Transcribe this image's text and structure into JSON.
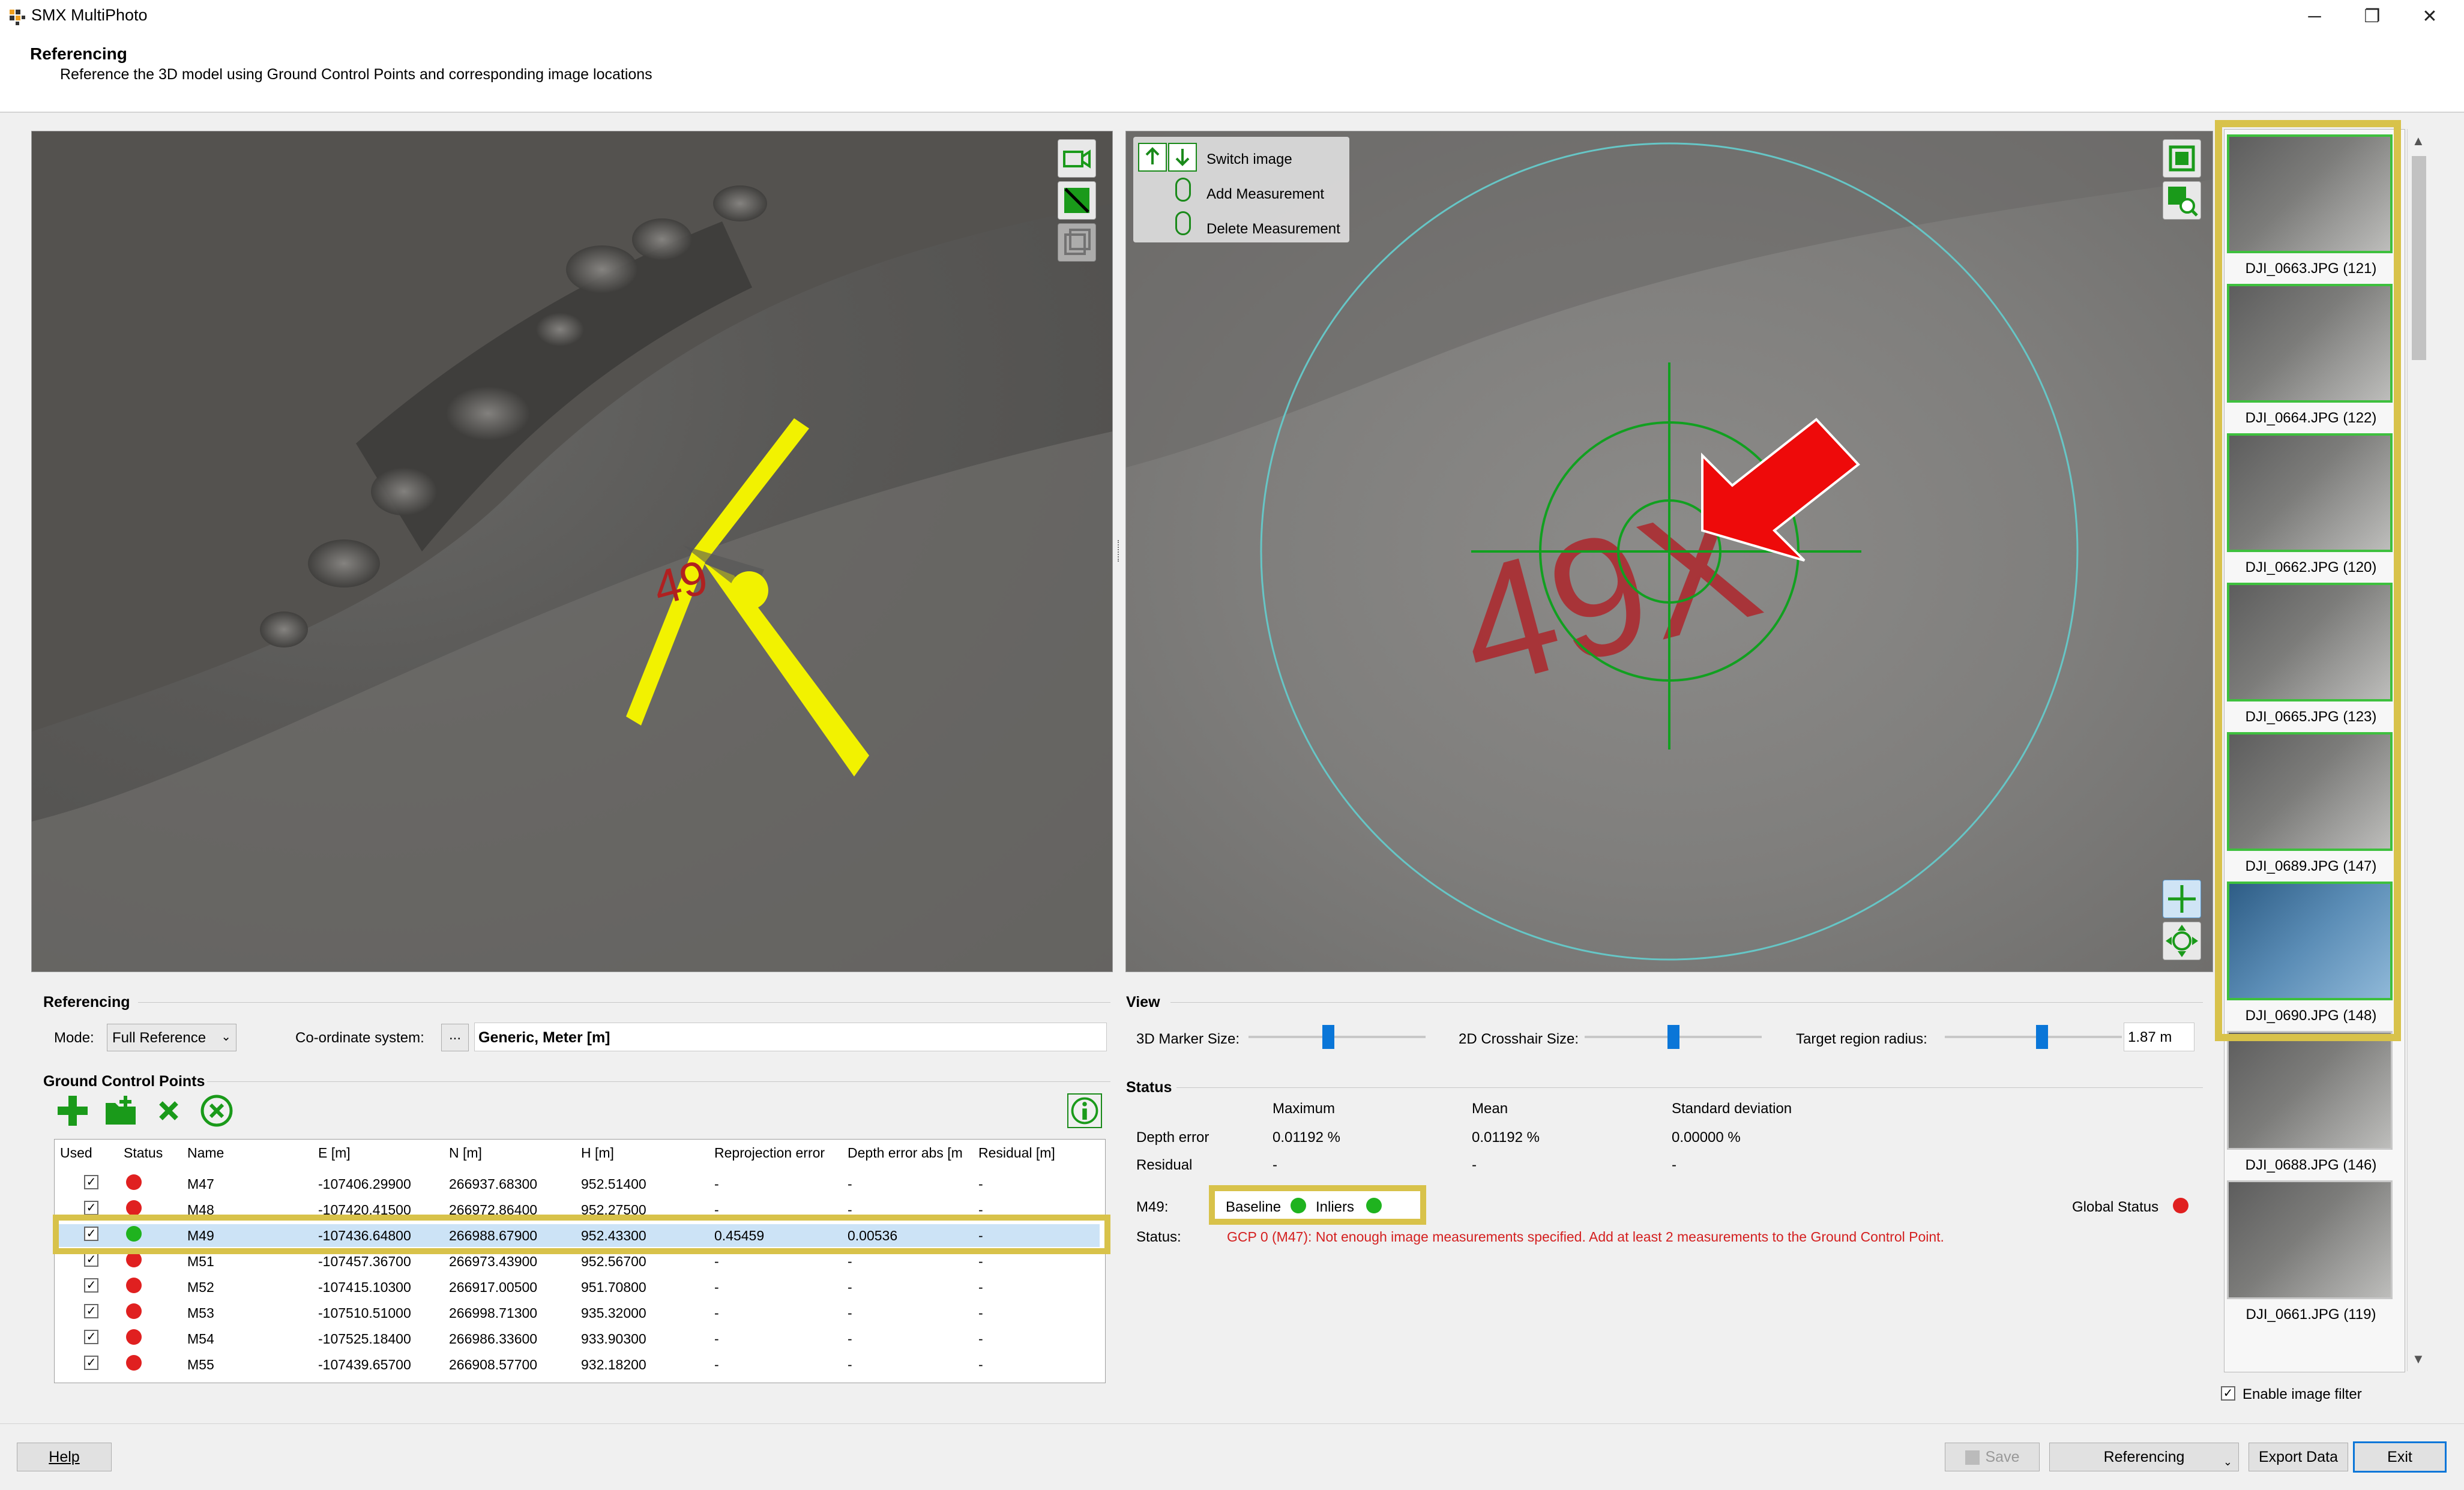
{
  "window": {
    "title": "SMX MultiPhoto",
    "minimize": "─",
    "maximize": "❐",
    "close": "✕"
  },
  "header": {
    "title": "Referencing",
    "subtitle": "Reference the 3D model using Ground Control Points and corresponding image locations"
  },
  "right_view": {
    "switch_image": "Switch image",
    "add_measurement": "Add Measurement",
    "delete_measurement": "Delete Measurement"
  },
  "thumbnails": [
    {
      "label": "DJI_0663.JPG (121)",
      "state": "measured"
    },
    {
      "label": "DJI_0664.JPG (122)",
      "state": "measured"
    },
    {
      "label": "DJI_0662.JPG (120)",
      "state": "measured"
    },
    {
      "label": "DJI_0665.JPG (123)",
      "state": "measured"
    },
    {
      "label": "DJI_0689.JPG (147)",
      "state": "measured"
    },
    {
      "label": "DJI_0690.JPG (148)",
      "state": "selected"
    },
    {
      "label": "DJI_0688.JPG (146)",
      "state": "plain"
    },
    {
      "label": "DJI_0661.JPG (119)",
      "state": "plain"
    }
  ],
  "enable_filter": "Enable image filter",
  "referencing": {
    "title": "Referencing",
    "mode_label": "Mode:",
    "mode_value": "Full Reference",
    "coord_label": "Co-ordinate system:",
    "coord_button": "...",
    "coord_value": "Generic, Meter [m]"
  },
  "gcp": {
    "title": "Ground Control Points",
    "columns": [
      "Used",
      "Status",
      "Name",
      "E [m]",
      "N [m]",
      "H [m]",
      "Reprojection error",
      "Depth error abs [m",
      "Residual [m]"
    ],
    "rows": [
      {
        "used": "✓",
        "status": "red",
        "name": "M47",
        "e": "-107406.29900",
        "n": "266937.68300",
        "h": "952.51400",
        "reproj": "-",
        "depth": "-",
        "resid": "-"
      },
      {
        "used": "✓",
        "status": "red",
        "name": "M48",
        "e": "-107420.41500",
        "n": "266972.86400",
        "h": "952.27500",
        "reproj": "-",
        "depth": "-",
        "resid": "-"
      },
      {
        "used": "✓",
        "status": "green",
        "name": "M49",
        "e": "-107436.64800",
        "n": "266988.67900",
        "h": "952.43300",
        "reproj": "0.45459",
        "depth": "0.00536",
        "resid": "-"
      },
      {
        "used": "✓",
        "status": "red",
        "name": "M51",
        "e": "-107457.36700",
        "n": "266973.43900",
        "h": "952.56700",
        "reproj": "-",
        "depth": "-",
        "resid": "-"
      },
      {
        "used": "✓",
        "status": "red",
        "name": "M52",
        "e": "-107415.10300",
        "n": "266917.00500",
        "h": "951.70800",
        "reproj": "-",
        "depth": "-",
        "resid": "-"
      },
      {
        "used": "✓",
        "status": "red",
        "name": "M53",
        "e": "-107510.51000",
        "n": "266998.71300",
        "h": "935.32000",
        "reproj": "-",
        "depth": "-",
        "resid": "-"
      },
      {
        "used": "✓",
        "status": "red",
        "name": "M54",
        "e": "-107525.18400",
        "n": "266986.33600",
        "h": "933.90300",
        "reproj": "-",
        "depth": "-",
        "resid": "-"
      },
      {
        "used": "✓",
        "status": "red",
        "name": "M55",
        "e": "-107439.65700",
        "n": "266908.57700",
        "h": "932.18200",
        "reproj": "-",
        "depth": "-",
        "resid": "-"
      }
    ]
  },
  "view": {
    "title": "View",
    "marker_label": "3D Marker Size:",
    "marker_level": 0.45,
    "crosshair_label": "2D Crosshair Size:",
    "crosshair_level": 0.5,
    "radius_label": "Target region radius:",
    "radius_level": 0.55,
    "radius_value": "1.87 m"
  },
  "status": {
    "title": "Status",
    "col_max": "Maximum",
    "col_mean": "Mean",
    "col_std": "Standard deviation",
    "depth_label": "Depth error",
    "depth_max": "0.01192 %",
    "depth_mean": "0.01192 %",
    "depth_std": "0.00000 %",
    "residual_label": "Residual",
    "residual_max": "-",
    "residual_mean": "-",
    "residual_std": "-",
    "point_label": "M49:",
    "baseline": "Baseline",
    "inliers": "Inliers",
    "global_status": "Global Status",
    "status_label": "Status:",
    "message": "GCP 0 (M47): Not enough image measurements specified. Add at least 2 measurements to the Ground Control Point."
  },
  "buttons": {
    "help": "Help",
    "save": "Save",
    "referencing": "Referencing",
    "export": "Export Data",
    "exit": "Exit"
  },
  "colors": {
    "red": "#e02020",
    "green": "#1fb31f",
    "highlight": "#d8c24a",
    "accent": "#0a76d8"
  },
  "viewport_labels": {
    "left_marker_text": "49",
    "right_marker_text": "49X"
  }
}
